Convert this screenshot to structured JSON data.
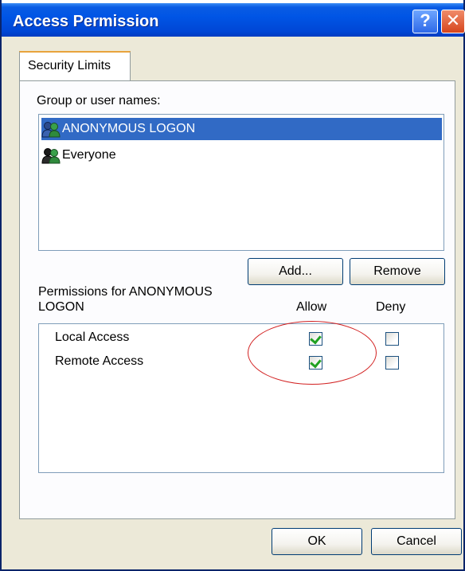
{
  "window": {
    "title": "Access Permission",
    "help_glyph": "?",
    "close_glyph": "✕"
  },
  "tabs": [
    {
      "label": "Security Limits",
      "active": true
    }
  ],
  "groups": {
    "label": "Group or user names:",
    "items": [
      {
        "name": "ANONYMOUS LOGON",
        "selected": true,
        "icon": "users-icon"
      },
      {
        "name": "Everyone",
        "selected": false,
        "icon": "users-icon"
      }
    ],
    "add_label": "Add...",
    "remove_label": "Remove"
  },
  "permissions": {
    "label_line1": "Permissions for ANONYMOUS",
    "label_line2": "LOGON",
    "allow_header": "Allow",
    "deny_header": "Deny",
    "rows": [
      {
        "name": "Local Access",
        "allow": true,
        "deny": false
      },
      {
        "name": "Remote Access",
        "allow": true,
        "deny": false
      }
    ]
  },
  "footer": {
    "ok_label": "OK",
    "cancel_label": "Cancel"
  },
  "colors": {
    "titlebar": "#0055e5",
    "selection": "#316ac5",
    "annotation_ellipse": "#d22020",
    "check": "#21a121"
  }
}
